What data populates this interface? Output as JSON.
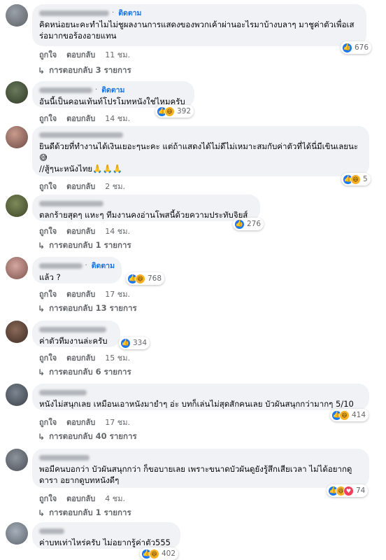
{
  "follow_label": "ติดตาม",
  "actions": {
    "like": "ถูกใจ",
    "reply": "ตอบกลับ"
  },
  "comments": [
    {
      "text": "คิดหน่อยนะคะทำไมไม่ชูผลงานการแสดงของพวกเค้าผ่านอะไรมาบ้างบลาๆ มาชูค่าตัวเพื่อเสร่อมากขอร้องอายแทน",
      "time": "11 ชม.",
      "reactions": "676",
      "replies": "การตอบกลับ 3 รายการ",
      "follow": true
    },
    {
      "text": "อันนี้เป็นคอนเท้นท์โปรโมทหนังใช่ไหมครับ",
      "time": "14 ชม.",
      "reactions": "392",
      "replies": "",
      "follow": true
    },
    {
      "text": "ยินดีด้วยที่ทำงานได้เงินเยอะๆนะคะ แต่ถ้าแสดงได้ไม่ดีไม่เหมาะสมกับค่าตัวที่ได้นี่มีเขินเลยนะ 😅",
      "text2": "//สู้ๆนะหนังไทย🙏🙏🙏",
      "time": "2 ชม.",
      "reactions": "5",
      "replies": "",
      "follow": false
    },
    {
      "text": "ตลกร้ายสุดๆ แหะๆ ทีมงานคงอ่านโพสนี้ด้วยความประทับจิยส์",
      "time": "14 ชม.",
      "reactions": "276",
      "replies": "การตอบกลับ 1 รายการ",
      "follow": false
    },
    {
      "text": "แล้ว ?",
      "time": "17 ชม.",
      "reactions": "768",
      "replies": "การตอบกลับ 13 รายการ",
      "follow": true
    },
    {
      "text": "ค่าตัวทีมงานล่ะครับ",
      "time": "15 ชม.",
      "reactions": "334",
      "replies": "การตอบกลับ 6 รายการ",
      "follow": false
    },
    {
      "text": "หนังไม่สนุกเลย เหมือนเอาหนังมายำๆ อ่ะ บทก็เล่นไม่สุดสักคนเลย บัวผันสนุกกว่ามากๆ 5/10",
      "time": "17 ชม.",
      "reactions": "414",
      "replies": "การตอบกลับ 40 รายการ",
      "follow": false
    },
    {
      "text": "พอมีคนบอกว่า บัวผันสนุกกว่า ก็ขอบายเลย เพราะขนาดบัวผันดูยังรู้สึกเสียเวลา ไม่ได้อยากดูดารา อยากดูบทหนังดีๆ",
      "time": "4 ชม.",
      "reactions": "74",
      "replies": "การตอบกลับ 1 รายการ",
      "follow": false
    },
    {
      "text": "ค่าบทเท่าไหร่ครับ ไม่อยากรู้ค่าตัว555",
      "time": "",
      "reactions": "402",
      "replies": "",
      "follow": false
    }
  ],
  "colors": {
    "accent": "#1b74e4",
    "bubble": "#f0f2f5",
    "like": "#1877f2",
    "haha": "#f7b125",
    "love": "#f33e58"
  }
}
